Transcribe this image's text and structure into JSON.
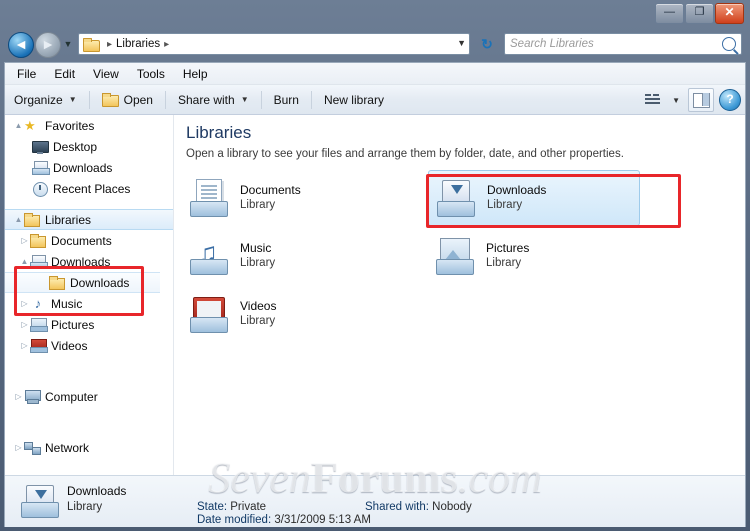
{
  "window": {
    "minimize_label": "—",
    "maximize_label": "❐",
    "close_label": "✕"
  },
  "address_bar": {
    "back_label": "◄",
    "forward_label": "►",
    "recent_dropdown_label": "▼",
    "breadcrumb": [
      "Libraries"
    ],
    "breadcrumb_trailing_sep": "▸",
    "breadcrumb_leading_sep": "▸",
    "dropdown_label": "▼",
    "refresh_label": "↻",
    "search_placeholder": "Search Libraries"
  },
  "menubar": {
    "items": [
      "File",
      "Edit",
      "View",
      "Tools",
      "Help"
    ]
  },
  "toolbar": {
    "organize_label": "Organize",
    "organize_caret": "▼",
    "open_label": "Open",
    "share_label": "Share with",
    "share_caret": "▼",
    "burn_label": "Burn",
    "new_library_label": "New library",
    "view_caret": "▼",
    "help_label": "?"
  },
  "navpane": {
    "items": [
      {
        "label": "Favorites",
        "icon": "star-icon",
        "twisty": "▲",
        "indent": 0
      },
      {
        "label": "Desktop",
        "icon": "desktop-icon",
        "twisty": "",
        "indent": 1
      },
      {
        "label": "Downloads",
        "icon": "downloads-icon",
        "twisty": "",
        "indent": 1
      },
      {
        "label": "Recent Places",
        "icon": "recent-places-icon",
        "twisty": "",
        "indent": 1
      },
      {
        "label": "Libraries",
        "icon": "libraries-icon",
        "twisty": "▲",
        "indent": 0,
        "selected": true
      },
      {
        "label": "Documents",
        "icon": "documents-library-icon",
        "twisty": "▷",
        "indent": 1
      },
      {
        "label": "Downloads",
        "icon": "downloads-library-icon",
        "twisty": "▲",
        "indent": 1
      },
      {
        "label": "Downloads",
        "icon": "downloads-folder-icon",
        "twisty": "",
        "indent": 2,
        "highlighted": true
      },
      {
        "label": "Music",
        "icon": "music-library-icon",
        "twisty": "▷",
        "indent": 1
      },
      {
        "label": "Pictures",
        "icon": "pictures-library-icon",
        "twisty": "▷",
        "indent": 1
      },
      {
        "label": "Videos",
        "icon": "videos-library-icon",
        "twisty": "▷",
        "indent": 1
      },
      {
        "label": "Computer",
        "icon": "computer-icon",
        "twisty": "▷",
        "indent": 0
      },
      {
        "label": "Network",
        "icon": "network-icon",
        "twisty": "▷",
        "indent": 0
      }
    ]
  },
  "content": {
    "heading": "Libraries",
    "subheading": "Open a library to see your files and arrange them by folder, date, and other properties.",
    "tiles": [
      {
        "name": "Documents",
        "type": "Library",
        "icon": "documents-library-icon",
        "selected": false
      },
      {
        "name": "Downloads",
        "type": "Library",
        "icon": "downloads-library-icon",
        "selected": true
      },
      {
        "name": "Music",
        "type": "Library",
        "icon": "music-library-icon",
        "selected": false
      },
      {
        "name": "Pictures",
        "type": "Library",
        "icon": "pictures-library-icon",
        "selected": false
      },
      {
        "name": "Videos",
        "type": "Library",
        "icon": "videos-library-icon",
        "selected": false
      }
    ]
  },
  "details": {
    "name": "Downloads",
    "type": "Library",
    "state_label": "State:",
    "state_value": "Private",
    "shared_label": "Shared with:",
    "shared_value": "Nobody",
    "modified_label": "Date modified:",
    "modified_value": "3/31/2009 5:13 AM"
  },
  "watermark": {
    "pre": "Seven",
    "mid": "Forums",
    "post": ".com"
  },
  "colors": {
    "highlight_red": "#e8262a",
    "selection_blue": "#9ecbeb",
    "heading_blue": "#1f3a63"
  }
}
